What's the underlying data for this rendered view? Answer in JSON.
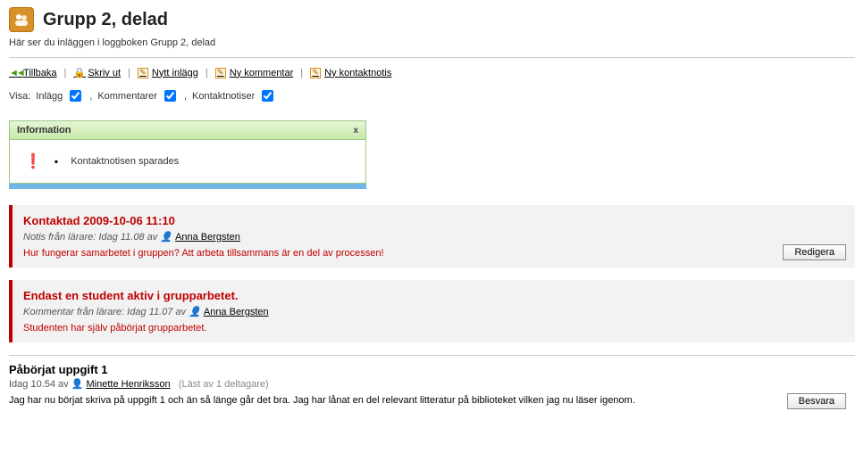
{
  "header": {
    "title": "Grupp 2, delad",
    "subtitle": "Här ser du inläggen i loggboken Grupp 2, delad"
  },
  "toolbar": {
    "back": "Tillbaka",
    "print": "Skriv ut",
    "new_post": "Nytt inlägg",
    "new_comment": "Ny kommentar",
    "new_contact": "Ny kontaktnotis"
  },
  "filter": {
    "label": "Visa:",
    "posts": "Inlägg",
    "comments": "Kommentarer",
    "contacts": "Kontaktnotiser"
  },
  "infobox": {
    "title": "Information",
    "close": "x",
    "message": "Kontaktnotisen sparades"
  },
  "entries": [
    {
      "title": "Kontaktad 2009-10-06 11:10",
      "meta_prefix": "Notis från lärare:",
      "meta_time": "Idag 11.08 av",
      "author": "Anna Bergsten",
      "body": "Hur fungerar samarbetet i gruppen? Att arbeta tillsammans är en del av processen!",
      "button": "Redigera"
    },
    {
      "title": "Endast en student aktiv i grupparbetet.",
      "meta_prefix": "Kommentar från lärare:",
      "meta_time": "Idag 11.07 av",
      "author": "Anna Bergsten",
      "body": "Studenten har själv påbörjat grupparbetet."
    }
  ],
  "plain_entry": {
    "title": "Påbörjat uppgift 1",
    "meta_time": "Idag 10.54 av",
    "author": "Minette Henriksson",
    "readby": "(Läst av 1 deltagare)",
    "body": "Jag har nu börjat skriva på uppgift 1 och än så länge går det bra. Jag har lånat en del relevant litteratur på biblioteket vilken jag nu läser igenom.",
    "button": "Besvara"
  }
}
